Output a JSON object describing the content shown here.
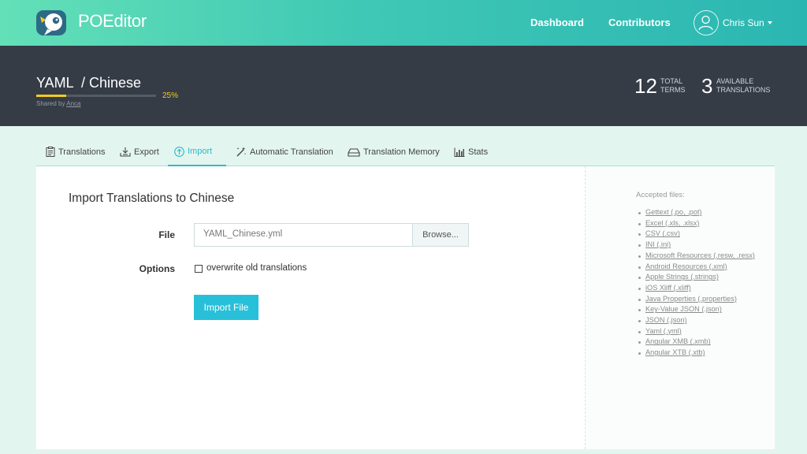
{
  "header": {
    "brand": "POEditor",
    "nav": [
      "Dashboard",
      "Contributors"
    ],
    "user": "Chris Sun"
  },
  "project": {
    "title": "YAML  / Chinese",
    "progress_percent": 25,
    "progress_label": "25%",
    "shared_prefix": "Shared by",
    "shared_by": "Anca",
    "stats": [
      {
        "number": "12",
        "label_line1": "TOTAL",
        "label_line2": "TERMS"
      },
      {
        "number": "3",
        "label_line1": "AVAILABLE",
        "label_line2": "TRANSLATIONS"
      }
    ]
  },
  "tabs": [
    {
      "label": "Translations",
      "icon": "clipboard-list-icon"
    },
    {
      "label": "Export",
      "icon": "download-icon"
    },
    {
      "label": "Import",
      "icon": "upload-circle-icon",
      "active": true
    },
    {
      "label": "Automatic Translation",
      "icon": "magic-wand-icon"
    },
    {
      "label": "Translation Memory",
      "icon": "hard-drive-icon"
    },
    {
      "label": "Stats",
      "icon": "bar-chart-icon"
    }
  ],
  "import_form": {
    "title": "Import Translations to Chinese",
    "file_label": "File",
    "file_value": "YAML_Chinese.yml",
    "browse_label": "Browse...",
    "options_label": "Options",
    "overwrite_label": "overwrite old translations",
    "overwrite_checked": false,
    "submit_label": "Import File"
  },
  "accepted_files": {
    "title": "Accepted files:",
    "items": [
      "Gettext (.po, .pot)",
      "Excel (.xls, .xlsx)",
      "CSV (.csv)",
      "INI (.ini)",
      "Microsoft Resources (.resw, .resx)",
      "Android Resources (.xml)",
      "Apple Strings (.strings)",
      "iOS Xliff (.xliff)",
      "Java Properties (.properties)",
      "Key-Value JSON (.json)",
      "JSON (.json)",
      "Yaml (.yml)",
      "Angular XMB (.xmb)",
      "Angular XTB (.xtb)"
    ]
  },
  "colors": {
    "accent": "#2eb9c9",
    "header_dark": "#353c46",
    "progress": "#f3cb22"
  }
}
